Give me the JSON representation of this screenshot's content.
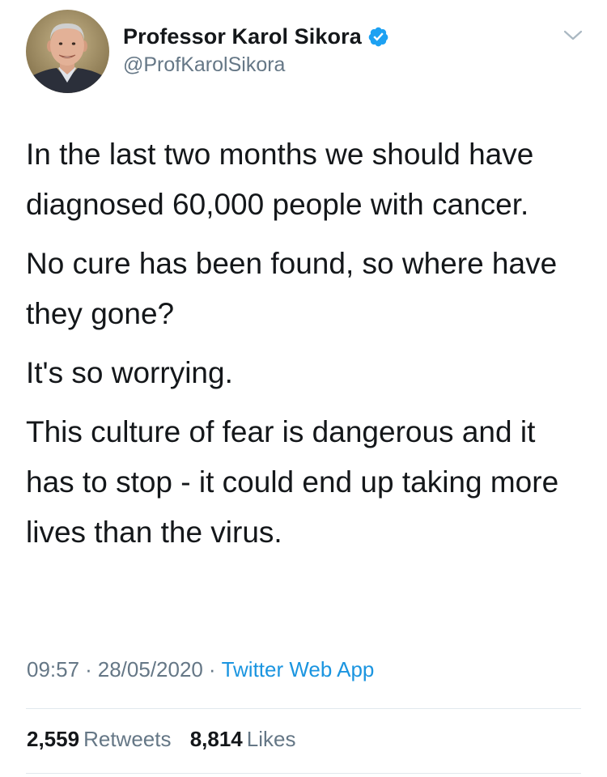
{
  "tweet": {
    "author": {
      "display_name": "Professor Karol Sikora",
      "handle": "@ProfKarolSikora",
      "verified": true,
      "verified_icon": "verified-badge-icon",
      "avatar": "profile-photo"
    },
    "menu_icon": "chevron-down-icon",
    "paragraphs": [
      "In the last two months we should have diagnosed 60,000 people with cancer.",
      "No cure has been found, so where have they gone?",
      "It's so worrying.",
      "This culture of fear is dangerous and it has to stop - it could end up taking more lives than the virus."
    ],
    "meta": {
      "time": "09:57",
      "separator": "·",
      "date": "28/05/2020",
      "source": "Twitter Web App"
    },
    "stats": {
      "retweets_count": "2,559",
      "retweets_label": "Retweets",
      "likes_count": "8,814",
      "likes_label": "Likes"
    }
  },
  "colors": {
    "text_primary": "#14171a",
    "text_secondary": "#657786",
    "link": "#1b95e0",
    "verified": "#1da1f2",
    "divider": "#e1e8ed"
  }
}
